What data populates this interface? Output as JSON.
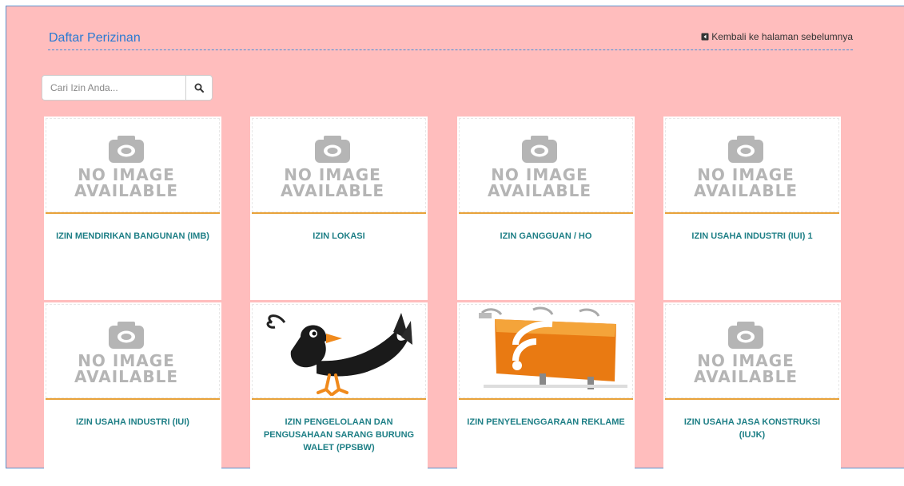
{
  "header": {
    "title": "Daftar Perizinan",
    "back_link": "Kembali ke halaman sebelumnya"
  },
  "search": {
    "placeholder": "Cari Izin Anda...",
    "button_icon": "search-icon"
  },
  "no_image": {
    "line1": "NO IMAGE",
    "line2": "AVAILABLE"
  },
  "colors": {
    "background": "#ffbdbd",
    "title": "#2a7ad2",
    "card_text": "#1e7f86",
    "card_rule": "#e8a23a"
  },
  "cards": [
    {
      "name": "IZIN MENDIRIKAN BANGUNAN (IMB)",
      "image": "no-image"
    },
    {
      "name": "IZIN LOKASI",
      "image": "no-image"
    },
    {
      "name": "IZIN GANGGUAN / HO",
      "image": "no-image"
    },
    {
      "name": "IZIN USAHA INDUSTRI (IUI) 1",
      "image": "no-image"
    },
    {
      "name": "IZIN USAHA INDUSTRI (IUI)",
      "image": "no-image"
    },
    {
      "name": "IZIN PENGELOLAAN DAN PENGUSAHAAN SARANG BURUNG WALET (PPSBW)",
      "image": "bird-image"
    },
    {
      "name": "IZIN PENYELENGGARAAN REKLAME",
      "image": "billboard-image"
    },
    {
      "name": "IZIN USAHA JASA KONSTRUKSI (IUJK)",
      "image": "no-image"
    }
  ]
}
